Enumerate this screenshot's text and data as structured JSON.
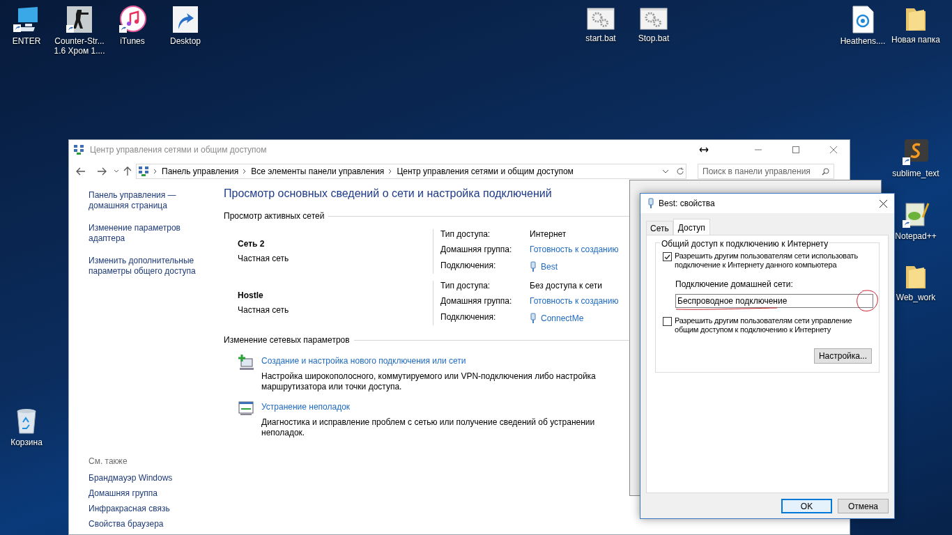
{
  "desktop": {
    "top_left_icons": [
      {
        "label": "ENTER",
        "kind": "monitor"
      },
      {
        "label": "Counter-Str... 1.6 Хром 1....",
        "kind": "game"
      },
      {
        "label": "iTunes",
        "kind": "music"
      },
      {
        "label": "Desktop",
        "kind": "shortcut"
      }
    ],
    "top_center_icons": [
      {
        "label": "start.bat",
        "kind": "batch"
      },
      {
        "label": "Stop.bat",
        "kind": "batch"
      }
    ],
    "top_right_icons": [
      {
        "label": "Heathens....",
        "kind": "media"
      },
      {
        "label": "Новая папка",
        "kind": "folder"
      }
    ],
    "right_column_icons": [
      {
        "label": "sublime_text",
        "kind": "editor"
      },
      {
        "label": "Notepad++",
        "kind": "notepad"
      },
      {
        "label": "Web_work",
        "kind": "folder"
      }
    ],
    "bottom_left_icons": [
      {
        "label": "Корзина",
        "kind": "recycle"
      }
    ]
  },
  "window": {
    "title": "Центр управления сетями и общим доступом",
    "breadcrumb": [
      "Панель управления",
      "Все элементы панели управления",
      "Центр управления сетями и общим доступом"
    ],
    "search": {
      "placeholder": "Поиск в панели управления"
    },
    "sidebar": {
      "links": [
        "Панель управления — домашняя страница",
        "Изменение параметров адаптера",
        "Изменить дополнительные параметры общего доступа"
      ],
      "see_also_heading": "См. также",
      "see_also": [
        "Брандмауэр Windows",
        "Домашняя группа",
        "Инфракрасная связь",
        "Свойства браузера"
      ]
    },
    "heading": "Просмотр основных сведений о сети и настройка подключений",
    "active_networks_heading": "Просмотр активных сетей",
    "networks": [
      {
        "name": "Сеть 2",
        "type": "Частная сеть",
        "access_label": "Тип доступа:",
        "access": "Интернет",
        "homegroup_label": "Домашняя группа:",
        "homegroup": "Готовность к созданию",
        "connections_label": "Подключения:",
        "connection": "Best"
      },
      {
        "name": "Hostle",
        "type": "Частная сеть",
        "access_label": "Тип доступа:",
        "access": "Без доступа к сети",
        "homegroup_label": "Домашняя группа:",
        "homegroup": "Готовность к созданию",
        "connections_label": "Подключения:",
        "connection": "ConnectMe"
      }
    ],
    "change_heading": "Изменение сетевых параметров",
    "tasks": [
      {
        "kind": "new-connection",
        "title": "Создание и настройка нового подключения или сети",
        "description": "Настройка широкополосного, коммутируемого или VPN-подключения либо настройка маршрутизатора или точки доступа."
      },
      {
        "kind": "troubleshoot",
        "title": "Устранение неполадок",
        "description": "Диагностика и исправление проблем с сетью или получение сведений об устранении неполадок."
      }
    ]
  },
  "dialog": {
    "title": "Best: свойства",
    "tabs": [
      {
        "label": "Сеть",
        "selected": false
      },
      {
        "label": "Доступ",
        "selected": true
      }
    ],
    "group_title": "Общий доступ к подключению к Интернету",
    "allow_sharing": {
      "label": "Разрешить другим пользователям сети использовать подключение к Интернету данного компьютера",
      "checked": true
    },
    "home_network_label": "Подключение домашней сети:",
    "home_network_value": "Беспроводное подключение",
    "allow_control": {
      "label": "Разрешить другим пользователям сети управление общим доступом к подключению к Интернету",
      "checked": false
    },
    "settings_button": "Настройка...",
    "buttons": [
      {
        "label": "OK",
        "default": true
      },
      {
        "label": "Отмена",
        "default": false
      }
    ]
  }
}
